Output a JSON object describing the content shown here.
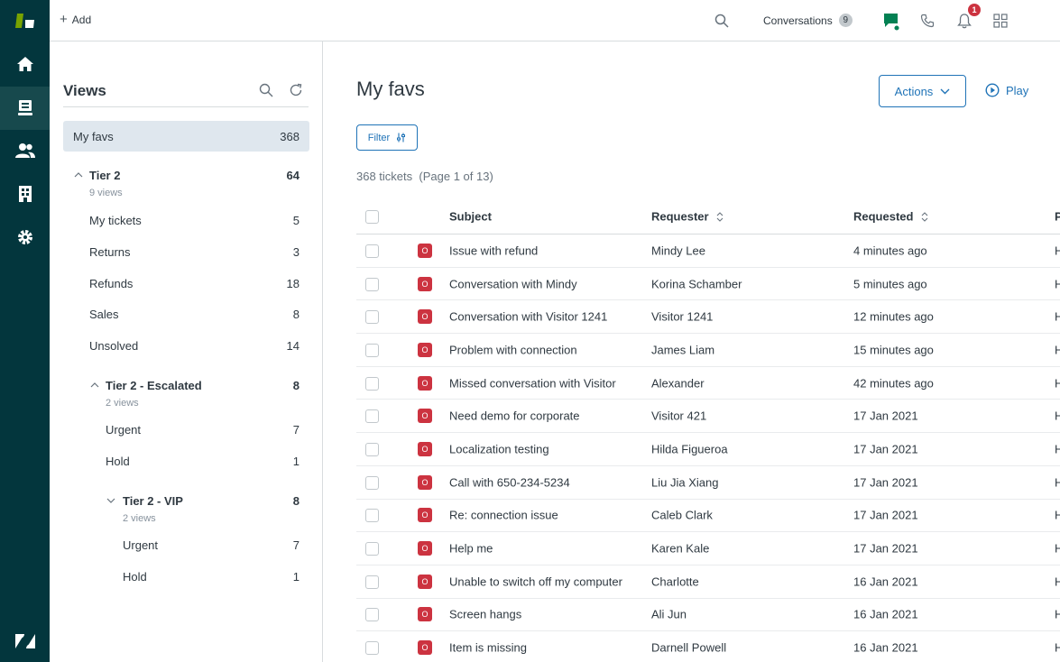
{
  "topbar": {
    "add_label": "Add",
    "conversations_label": "Conversations",
    "conversations_count": "9",
    "notifications_count": "1"
  },
  "views_panel": {
    "title": "Views",
    "items": [
      {
        "label": "My favs",
        "count": "368"
      },
      {
        "label": "Tier 2",
        "count": "64",
        "sub": "9 views"
      },
      {
        "label": "My tickets",
        "count": "5"
      },
      {
        "label": "Returns",
        "count": "3"
      },
      {
        "label": "Refunds",
        "count": "18"
      },
      {
        "label": "Sales",
        "count": "8"
      },
      {
        "label": "Unsolved",
        "count": "14"
      },
      {
        "label": "Tier 2 - Escalated",
        "count": "8",
        "sub": "2 views"
      },
      {
        "label": "Urgent",
        "count": "7"
      },
      {
        "label": "Hold",
        "count": "1"
      },
      {
        "label": "Tier 2 - VIP",
        "count": "8",
        "sub": "2 views"
      },
      {
        "label": "Urgent",
        "count": "7"
      },
      {
        "label": "Hold",
        "count": "1"
      }
    ]
  },
  "main": {
    "title": "My favs",
    "actions_label": "Actions",
    "play_label": "Play",
    "filter_label": "Filter",
    "ticket_count": "368 tickets",
    "page_info": "(Page 1 of 13)",
    "columns": [
      "Subject",
      "Requester",
      "Requested",
      "P"
    ],
    "status_letter": "O",
    "rows": [
      {
        "subject": "Issue with refund",
        "requester": "Mindy Lee",
        "requested": "4 minutes ago",
        "p": "H"
      },
      {
        "subject": "Conversation with Mindy",
        "requester": "Korina Schamber",
        "requested": "5 minutes ago",
        "p": "H"
      },
      {
        "subject": "Conversation with Visitor 1241",
        "requester": "Visitor 1241",
        "requested": "12 minutes ago",
        "p": "H"
      },
      {
        "subject": "Problem with connection",
        "requester": "James Liam",
        "requested": "15 minutes ago",
        "p": "H"
      },
      {
        "subject": "Missed conversation with Visitor",
        "requester": "Alexander",
        "requested": "42 minutes ago",
        "p": "H"
      },
      {
        "subject": "Need demo for corporate",
        "requester": "Visitor 421",
        "requested": "17 Jan 2021",
        "p": "H"
      },
      {
        "subject": "Localization testing",
        "requester": "Hilda Figueroa",
        "requested": "17 Jan 2021",
        "p": "H"
      },
      {
        "subject": "Call with 650-234-5234",
        "requester": "Liu Jia Xiang",
        "requested": "17 Jan 2021",
        "p": "H"
      },
      {
        "subject": "Re: connection issue",
        "requester": "Caleb Clark",
        "requested": "17 Jan 2021",
        "p": "H"
      },
      {
        "subject": "Help me",
        "requester": "Karen Kale",
        "requested": "17 Jan 2021",
        "p": "H"
      },
      {
        "subject": "Unable to switch off my computer",
        "requester": "Charlotte",
        "requested": "16 Jan 2021",
        "p": "H"
      },
      {
        "subject": "Screen hangs",
        "requester": "Ali Jun",
        "requested": "16 Jan 2021",
        "p": "H"
      },
      {
        "subject": "Item is missing",
        "requester": "Darnell Powell",
        "requested": "16 Jan 2021",
        "p": "H"
      }
    ]
  },
  "icons": [
    "zendesk-logo-icon",
    "home-icon",
    "views-icon",
    "customers-icon",
    "organizations-icon",
    "admin-gear-icon",
    "zendesk-z-icon",
    "search-icon",
    "chat-icon",
    "phone-icon",
    "bell-icon",
    "apps-grid-icon",
    "refresh-icon",
    "chevron-down-icon",
    "play-icon",
    "filter-sliders-icon",
    "sort-icon"
  ],
  "colors": {
    "rail": "#03363d",
    "accent": "#1f73b7",
    "status_open": "#cc3340",
    "online": "#038153"
  }
}
